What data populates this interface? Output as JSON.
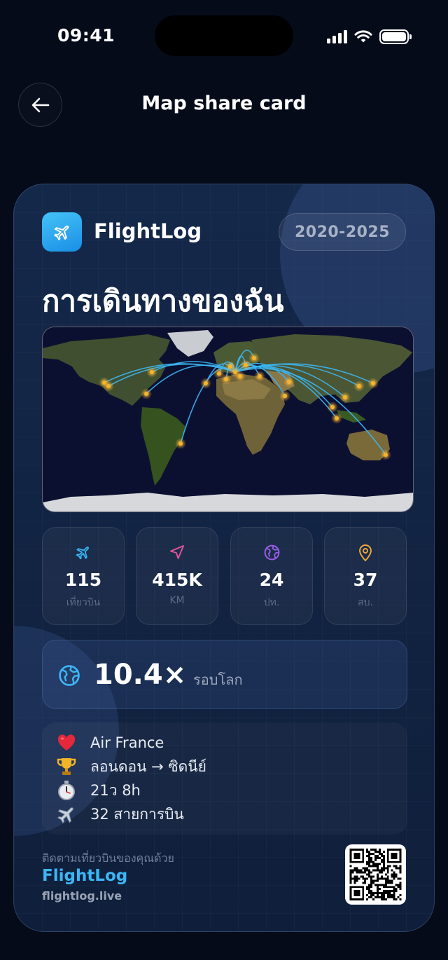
{
  "status_bar": {
    "time": "09:41"
  },
  "header": {
    "title": "Map share card",
    "back_icon": "arrow-left-icon"
  },
  "card": {
    "brand": "FlightLog",
    "logo_icon": "airplane-icon",
    "year_range": "2020-2025",
    "title": "การเดินทางของฉัน",
    "map": {
      "icon": "world-map",
      "arc_color": "#3bb6f3",
      "dot_color": "#f6b42c"
    },
    "stats": [
      {
        "icon": "airplane-icon",
        "color": "#38b6f2",
        "value": "115",
        "label": "เที่ยวบิน"
      },
      {
        "icon": "navigation-arrow-icon",
        "color": "#e0559a",
        "value": "415K",
        "label": "KM"
      },
      {
        "icon": "globe-icon",
        "color": "#9a5de8",
        "value": "24",
        "label": "ปท."
      },
      {
        "icon": "location-pin-icon",
        "color": "#f1a93a",
        "value": "37",
        "label": "สบ."
      }
    ],
    "laps": {
      "icon": "globe-icon",
      "value": "10.4×",
      "label": "รอบโลก"
    },
    "facts": [
      {
        "icon": "heart-icon",
        "text": "Air France"
      },
      {
        "icon": "trophy-icon",
        "text": "ลอนดอน → ซิดนีย์"
      },
      {
        "icon": "stopwatch-icon",
        "text": "21ว 8h"
      },
      {
        "icon": "airplane-icon",
        "text": "32 สายการบิน"
      }
    ],
    "footer": {
      "hint": "ติดตามเที่ยวบินของคุณด้วย",
      "brand": "FlightLog",
      "url": "flightlog.live",
      "qr_icon": "qr-code"
    }
  }
}
